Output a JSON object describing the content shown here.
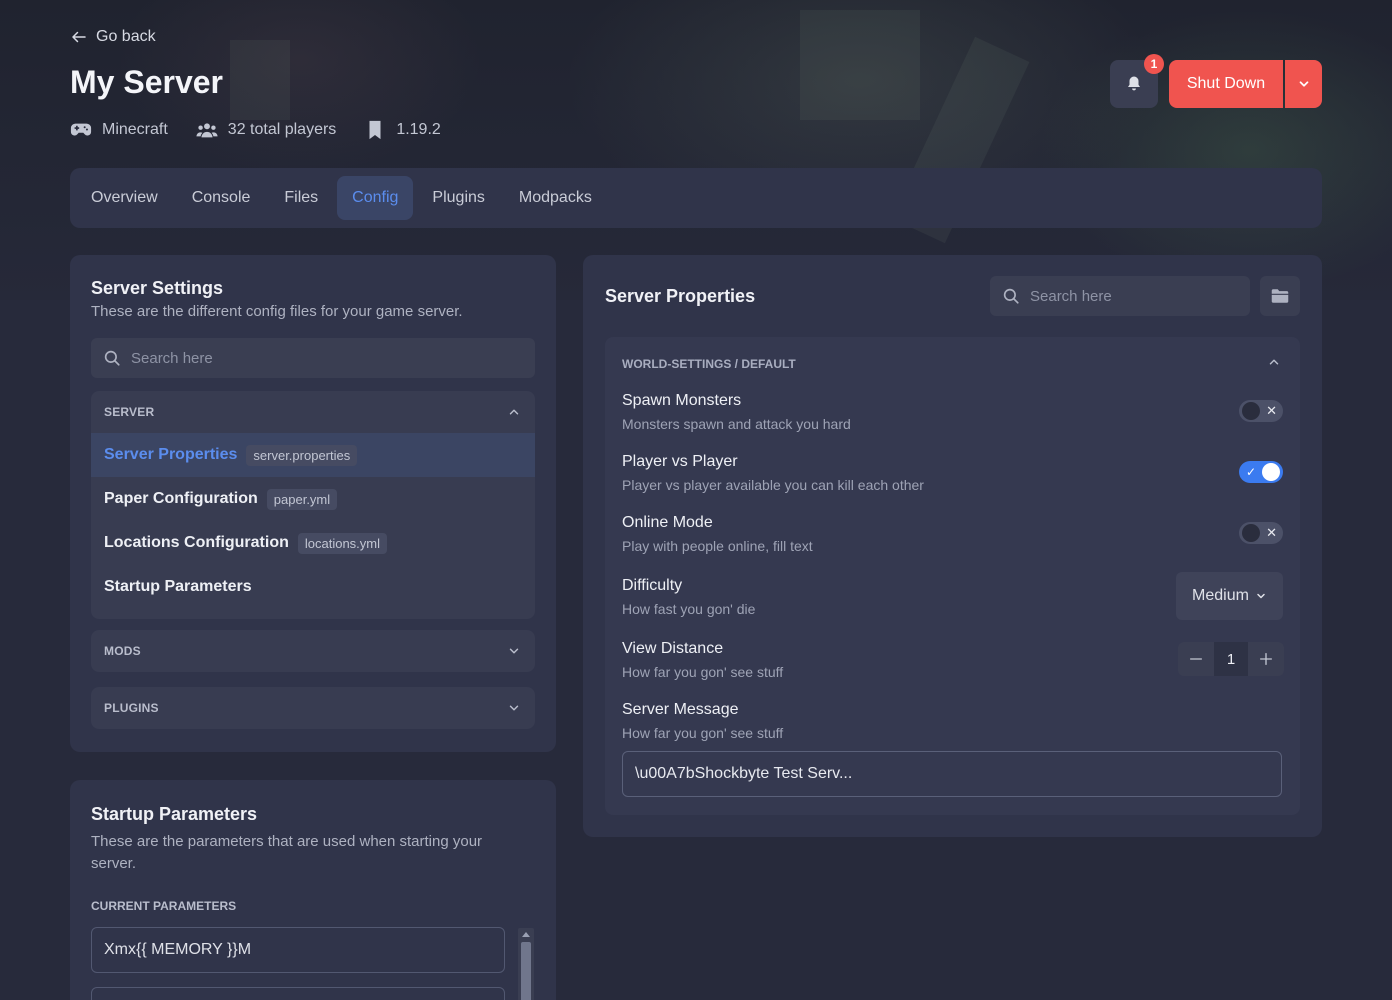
{
  "header": {
    "back_label": "Go back",
    "title": "My Server",
    "meta": {
      "game": "Minecraft",
      "players": "32 total players",
      "version": "1.19.2"
    },
    "notifications_count": "1",
    "shutdown_label": "Shut Down"
  },
  "tabs": [
    {
      "label": "Overview",
      "active": false
    },
    {
      "label": "Console",
      "active": false
    },
    {
      "label": "Files",
      "active": false
    },
    {
      "label": "Config",
      "active": true
    },
    {
      "label": "Plugins",
      "active": false
    },
    {
      "label": "Modpacks",
      "active": false
    }
  ],
  "server_settings": {
    "title": "Server Settings",
    "description": "These are the different config files for your game server.",
    "search_placeholder": "Search here",
    "groups": {
      "server": {
        "label": "SERVER",
        "items": [
          {
            "name": "Server Properties",
            "file": "server.properties",
            "active": true
          },
          {
            "name": "Paper Configuration",
            "file": "paper.yml",
            "active": false
          },
          {
            "name": "Locations Configuration",
            "file": "locations.yml",
            "active": false
          },
          {
            "name": "Startup Parameters",
            "file": "",
            "active": false
          }
        ]
      },
      "mods": {
        "label": "MODS"
      },
      "plugins": {
        "label": "PLUGINS"
      }
    }
  },
  "startup_parameters": {
    "title": "Startup Parameters",
    "description": "These are the parameters that are used when starting your server.",
    "current_label": "CURRENT PARAMETERS",
    "params": [
      "Xmx{{ MEMORY }}M",
      ""
    ]
  },
  "server_properties": {
    "title": "Server Properties",
    "search_placeholder": "Search here",
    "section_label": "WORLD-SETTINGS / DEFAULT",
    "settings": {
      "spawn_monsters": {
        "title": "Spawn Monsters",
        "desc": "Monsters spawn and attack you hard",
        "value": false
      },
      "pvp": {
        "title": "Player vs Player",
        "desc": "Player vs player available you can kill each other",
        "value": true
      },
      "online_mode": {
        "title": "Online Mode",
        "desc": "Play with people online, fill text",
        "value": false
      },
      "difficulty": {
        "title": "Difficulty",
        "desc": "How fast you gon' die",
        "value": "Medium"
      },
      "view_distance": {
        "title": "View Distance",
        "desc": "How far you gon' see stuff",
        "value": "1"
      },
      "server_message": {
        "title": "Server Message",
        "desc": "How far you gon' see stuff",
        "value": "\\u00A7bShockbyte Test Serv..."
      }
    }
  },
  "colors": {
    "accent": "#5b8dee",
    "danger": "#f0544f",
    "toggle_on": "#3b7bf0",
    "panel": "#30344a"
  }
}
